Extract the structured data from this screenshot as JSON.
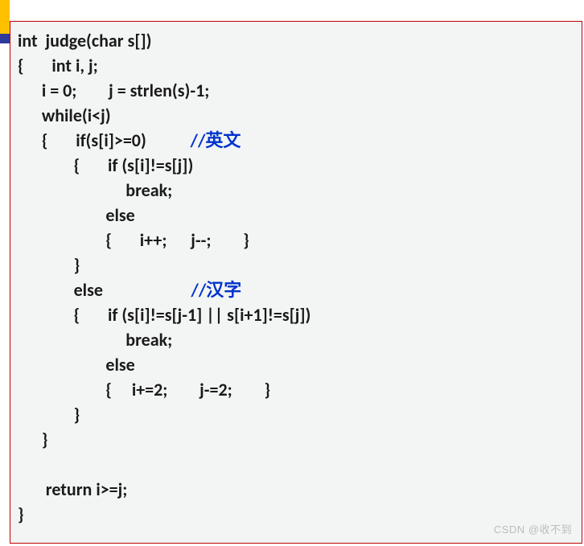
{
  "code": {
    "l1": " int  judge(char s[])",
    "l2": " {       int i, j;",
    "l3": "       i = 0;        j = strlen(s)-1;",
    "l4": "       while(i<j)",
    "l5a": "       {       if(s[i]>=0)           ",
    "l5b": "//英文",
    "l6": "               {       if (s[i]!=s[j])",
    "l7": "                            break;",
    "l8": "                       else",
    "l9": "                       {       i++;      j--;        }",
    "l10": "               }",
    "l11a": "               else                      ",
    "l11b": "//汉字",
    "l12": "               {       if (s[i]!=s[j-1] || s[i+1]!=s[j])",
    "l13": "                            break;",
    "l14": "                       else",
    "l15": "                       {     i+=2;        j-=2;        }",
    "l16": "               }",
    "l17": "       }",
    "l18": "",
    "l19": "        return i>=j;",
    "l20": " }"
  },
  "watermark": "CSDN @收不到"
}
